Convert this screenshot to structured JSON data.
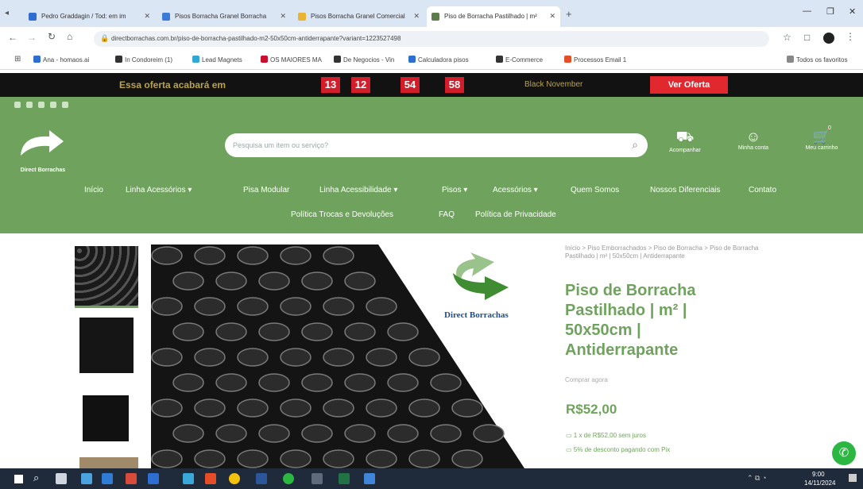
{
  "browser": {
    "tabs": [
      {
        "label": "Pedro Graddagin / Tod: em im",
        "favicon_color": "#2f6ed1"
      },
      {
        "label": "Pisos Borracha Granel Borracha",
        "favicon_color": "#3b7bd8"
      },
      {
        "label": "Pisos Borracha Granel Comercial",
        "favicon_color": "#e8b331"
      },
      {
        "label": "Piso de Borracha Pastilhado | m²",
        "favicon_color": "#5c7d4b"
      }
    ],
    "url": "directborrachas.com.br/piso-de-borracha-pastilhado-m2-50x50cm-antiderrapante?variant=1223527498",
    "bookmarks": [
      {
        "label": "Ana - homaos.ai",
        "color": "#2f6ed1"
      },
      {
        "label": "In Condoreim (1)",
        "color": "#333"
      },
      {
        "label": "Lead Magnets",
        "color": "#2fa8d8"
      },
      {
        "label": "OS MAIORES MA",
        "color": "#c8102e"
      },
      {
        "label": "De Negocios - Vin",
        "color": "#333"
      },
      {
        "label": "Calculadora pisos",
        "color": "#2f6ed1"
      },
      {
        "label": "E-Commerce",
        "color": "#333"
      },
      {
        "label": "Processos Email 1",
        "color": "#e44d26"
      },
      {
        "label": "Todos os favoritos",
        "color": "#888"
      }
    ]
  },
  "promo": {
    "text": "Essa oferta acabará em",
    "timer": [
      "13",
      "12",
      "54",
      "58"
    ],
    "event": "Black November",
    "cta": "Ver Oferta"
  },
  "header": {
    "logo_text": "Direct Borrachas",
    "search_placeholder": "Pesquisa um item ou serviço?",
    "icons": [
      {
        "label": "Acompanhar",
        "icon": "truck-icon"
      },
      {
        "label": "Minha conta",
        "icon": "user-icon"
      },
      {
        "label": "Meu carrinho",
        "icon": "cart-icon"
      }
    ],
    "cart_count": "0"
  },
  "nav": {
    "row1": [
      "Início",
      "Linha Acessórios ▾",
      "Pisa Modular",
      "Linha Acessibilidade ▾",
      "Pisos ▾",
      "Acessórios ▾",
      "Quem Somos",
      "Nossos Diferenciais",
      "Contato"
    ],
    "row2": [
      "Política Trocas e Devoluções",
      "FAQ",
      "Política de Privacidade"
    ]
  },
  "product": {
    "breadcrumb": "Início > Piso Emborrachados > Piso de Borracha > Piso de Borracha Pastilhado | m² | 50x50cm | Antiderrapante",
    "title": "Piso de Borracha Pastilhado | m² | 50x50cm | Antiderrapante",
    "rating_text": "Comprar agora",
    "price": "R$52,00",
    "installments": "1 x de R$52,00 sem juros",
    "discount": "5% de desconto pagando com Pix",
    "brand": "Direct Borrachas"
  },
  "taskbar": {
    "time": "9:00",
    "date": "14/11/2024"
  }
}
